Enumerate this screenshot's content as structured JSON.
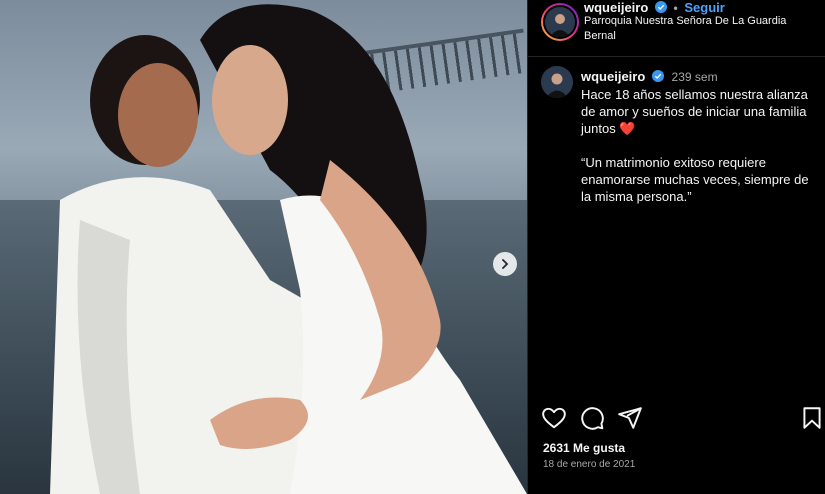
{
  "post": {
    "username": "wqueijeiro",
    "follow_label": "Seguir",
    "separator": "•",
    "location": "Parroquia Nuestra Señora De La Guardia Bernal",
    "caption_time": "239 sem",
    "caption_text": "Hace 18 años sellamos nuestra alianza de amor y sueños de iniciar una familia juntos ❤️\n\n“Un matrimonio exitoso requiere enamorarse muchas veces, siempre de la misma persona.”",
    "likes": "2631 Me gusta",
    "date": "18 de enero de 2021"
  },
  "icons": [
    "verified-icon",
    "chevron-right-icon",
    "heart-icon",
    "comment-icon",
    "share-icon",
    "bookmark-icon"
  ],
  "colors": {
    "background": "#000000",
    "follow": "#4aa3ff",
    "verified": "#3897f0",
    "muted": "#a8a8a8"
  }
}
